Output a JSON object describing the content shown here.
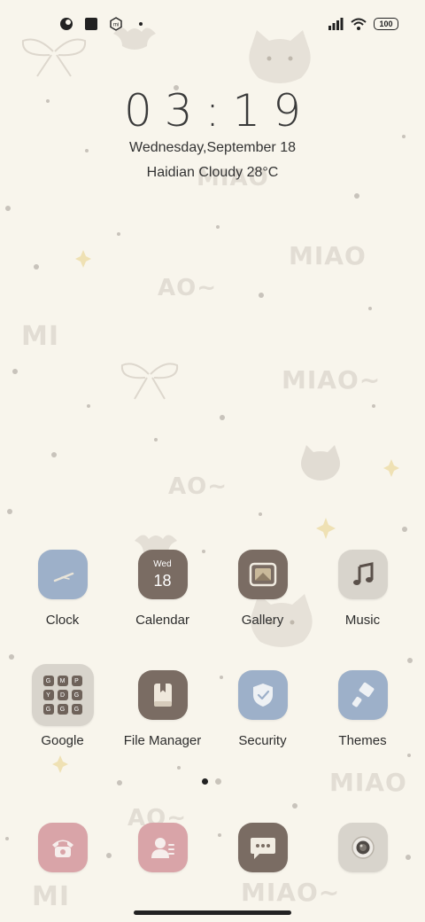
{
  "status_bar": {
    "battery": "100",
    "icons": [
      "color-circle-icon",
      "square-app-icon",
      "mi-hexagon-icon",
      "dot-icon",
      "signal-icon",
      "wifi-icon",
      "battery-icon"
    ]
  },
  "clock": {
    "time": "03:19",
    "date": "Wednesday,September 18",
    "weather": "Haidian Cloudy 28°C"
  },
  "apps_row1": [
    {
      "label": "Clock",
      "icon": "clock-icon",
      "bg": "#9db0c9"
    },
    {
      "label": "Calendar",
      "icon": "calendar-icon",
      "bg": "#7a6c63",
      "day": "Wed",
      "date": "18"
    },
    {
      "label": "Gallery",
      "icon": "gallery-icon",
      "bg": "#7a6c63"
    },
    {
      "label": "Music",
      "icon": "music-icon",
      "bg": "#d8d4cc"
    }
  ],
  "apps_row2": [
    {
      "label": "Google",
      "icon": "google-folder-icon",
      "bg": "#d8d4cc"
    },
    {
      "label": "File Manager",
      "icon": "file-manager-icon",
      "bg": "#7a6c63"
    },
    {
      "label": "Security",
      "icon": "shield-icon",
      "bg": "#9db0c9"
    },
    {
      "label": "Themes",
      "icon": "themes-icon",
      "bg": "#9db0c9"
    }
  ],
  "google_folder_letters": [
    "G",
    "M",
    "P",
    "Y",
    "D",
    "G",
    "G",
    "G",
    "G"
  ],
  "dock": [
    {
      "icon": "phone-icon",
      "bg": "#d9a4a8"
    },
    {
      "icon": "contacts-icon",
      "bg": "#d9a4a8"
    },
    {
      "icon": "messages-icon",
      "bg": "#7a6c63"
    },
    {
      "icon": "camera-icon",
      "bg": "#d8d4cc"
    }
  ],
  "page_indicator": {
    "active": 1,
    "count": 2
  },
  "colors": {
    "background": "#f8f5ec",
    "text": "#2d2d2d",
    "accent_blue": "#9db0c9",
    "accent_brown": "#7a6c63",
    "accent_pink": "#d9a4a8"
  }
}
